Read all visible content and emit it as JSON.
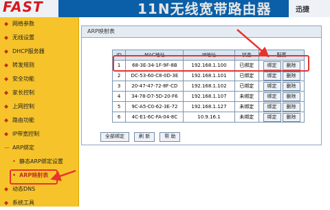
{
  "header": {
    "logo": "FAST",
    "title": "11N无线宽带路由器",
    "right_text": "迅捷"
  },
  "sidebar": {
    "items": [
      {
        "label": "网络参数"
      },
      {
        "label": "无线设置"
      },
      {
        "label": "DHCP服务器"
      },
      {
        "label": "转发规则"
      },
      {
        "label": "安全功能"
      },
      {
        "label": "家长控制"
      },
      {
        "label": "上网控制"
      },
      {
        "label": "路由功能"
      },
      {
        "label": "IP带宽控制"
      },
      {
        "label": "ARP绑定"
      },
      {
        "label": "静态ARP绑定设置"
      },
      {
        "label": "ARP映射表"
      },
      {
        "label": "动态DNS"
      },
      {
        "label": "系统工具"
      }
    ]
  },
  "panel": {
    "title": "ARP映射表",
    "table": {
      "headers": [
        "ID",
        "MAC地址",
        "IP地址",
        "状态",
        "配置"
      ],
      "rows": [
        {
          "id": "1",
          "mac": "68-3E-34-1F-9F-8B",
          "ip": "192.168.1.100",
          "status": "已绑定"
        },
        {
          "id": "2",
          "mac": "DC-53-60-C8-0D-3E",
          "ip": "192.168.1.101",
          "status": "已绑定"
        },
        {
          "id": "3",
          "mac": "20-47-47-72-8F-CD",
          "ip": "192.168.1.102",
          "status": "已绑定"
        },
        {
          "id": "4",
          "mac": "34-78-D7-5D-20-F6",
          "ip": "192.168.1.107",
          "status": "未绑定"
        },
        {
          "id": "5",
          "mac": "9C-A5-C0-62-3E-72",
          "ip": "192.168.1.127",
          "status": "未绑定"
        },
        {
          "id": "6",
          "mac": "4C-E1-6C-FA-04-8C",
          "ip": "10.9.16.1",
          "status": "未绑定"
        }
      ],
      "bind_label": "绑定",
      "delete_label": "删除"
    },
    "buttons": {
      "bind_all": "全部绑定",
      "refresh": "刷 新",
      "help": "帮 助"
    }
  },
  "colors": {
    "accent_red": "#e8322c",
    "sidebar_bg": "#f6c42a",
    "header_bg": "#0a5fa8"
  }
}
